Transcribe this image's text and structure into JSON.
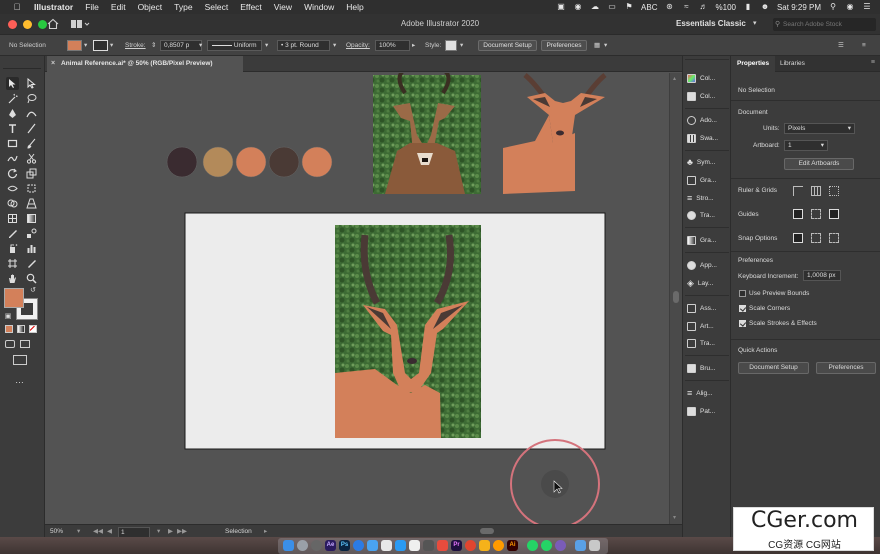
{
  "menubar": {
    "app_name": "Illustrator",
    "items": [
      "File",
      "Edit",
      "Object",
      "Type",
      "Select",
      "Effect",
      "View",
      "Window",
      "Help"
    ],
    "status_abc": "ABC",
    "battery": "%100",
    "clock": "Sat 9:29 PM"
  },
  "titlebar": {
    "title": "Adobe Illustrator 2020",
    "workspace": "Essentials Classic",
    "stock_placeholder": "Search Adobe Stock"
  },
  "controlbar": {
    "selection": "No Selection",
    "stroke_label": "Stroke:",
    "stroke_value": "0,8507 p",
    "profile": "Uniform",
    "brush": "3 pt. Round",
    "opacity_label": "Opacity:",
    "opacity_value": "100%",
    "style_label": "Style:",
    "document_setup": "Document Setup",
    "preferences": "Preferences"
  },
  "document": {
    "tab_title": "Animal Reference.ai* @ 50% (RGB/Pixel Preview)"
  },
  "statusbar": {
    "zoom": "50%",
    "artboard": "1",
    "tool": "Selection"
  },
  "palette": {
    "colors": [
      "#3a2b30",
      "#b38a5a",
      "#d3805a",
      "#4a3a35",
      "#d3805a"
    ]
  },
  "tools": {
    "fill_color": "#d3805a"
  },
  "iconpanel": {
    "items": [
      "Col...",
      "Col...",
      "Ado...",
      "Swa...",
      "Sym...",
      "Gra...",
      "Stro...",
      "Tra...",
      "Gra...",
      "App...",
      "Lay...",
      "Ass...",
      "Art...",
      "Tra...",
      "Bru...",
      "Alig...",
      "Pat..."
    ]
  },
  "properties": {
    "tabs": [
      "Properties",
      "Libraries"
    ],
    "no_selection": "No Selection",
    "document_header": "Document",
    "units_label": "Units:",
    "units_value": "Pixels",
    "artboard_label": "Artboard:",
    "artboard_value": "1",
    "edit_artboards": "Edit Artboards",
    "ruler_grids": "Ruler & Grids",
    "guides": "Guides",
    "snap_options": "Snap Options",
    "preferences_header": "Preferences",
    "keyboard_increment_label": "Keyboard Increment:",
    "keyboard_increment_value": "1,0008 px",
    "use_preview_bounds": "Use Preview Bounds",
    "scale_corners": "Scale Corners",
    "scale_strokes": "Scale Strokes & Effects",
    "use_preview_bounds_checked": false,
    "scale_corners_checked": true,
    "scale_strokes_checked": true,
    "quick_actions": "Quick Actions",
    "qa_document_setup": "Document Setup",
    "qa_preferences": "Preferences"
  },
  "watermark": {
    "line1": "CGer.com",
    "line2": "CG资源 CG网站"
  }
}
